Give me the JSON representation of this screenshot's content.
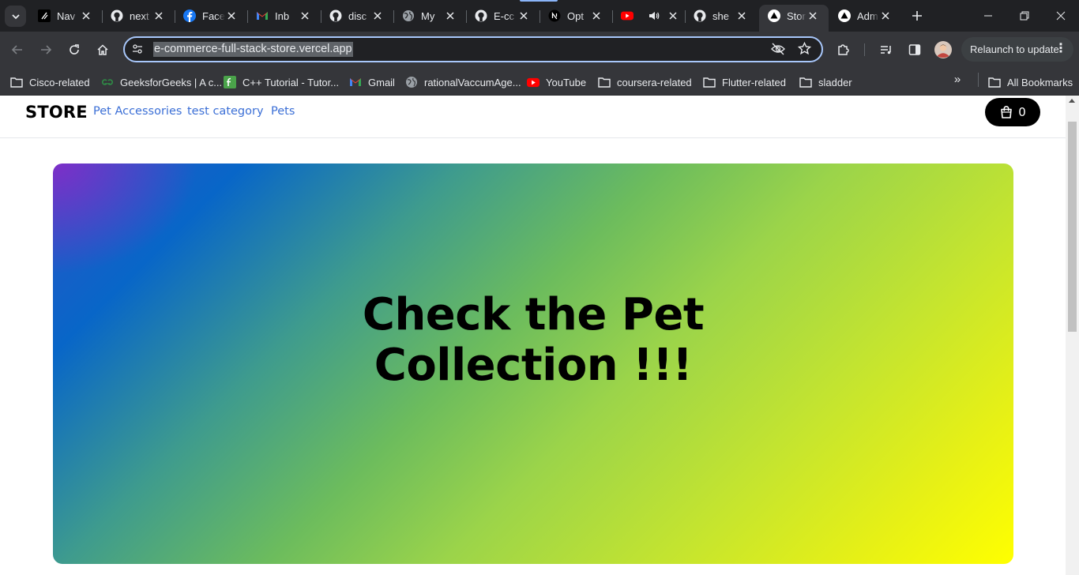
{
  "browser": {
    "tabs": [
      {
        "title": "Nav",
        "icon": "vercel-slash-icon"
      },
      {
        "title": "next",
        "icon": "github-icon"
      },
      {
        "title": "Face",
        "icon": "facebook-icon"
      },
      {
        "title": "Inb",
        "icon": "gmail-icon"
      },
      {
        "title": "disc",
        "icon": "github-icon"
      },
      {
        "title": "My",
        "icon": "globe-icon"
      },
      {
        "title": "E-cc",
        "icon": "github-icon"
      },
      {
        "title": "Opt",
        "icon": "nextjs-icon"
      },
      {
        "title": "",
        "icon": "youtube-icon"
      },
      {
        "title": "she",
        "icon": "github-icon"
      },
      {
        "title": "Stor",
        "icon": "vercel-triangle-icon",
        "active": true
      },
      {
        "title": "Adm",
        "icon": "vercel-triangle-icon"
      }
    ],
    "address": {
      "url": "e-commerce-full-stack-store.vercel.app"
    },
    "relaunch_label": "Relaunch to update",
    "bookmarks": [
      {
        "label": "Cisco-related",
        "icon": "folder-icon"
      },
      {
        "label": "GeeksforGeeks | A c...",
        "icon": "geeksforgeeks-icon"
      },
      {
        "label": "C++ Tutorial - Tutor...",
        "icon": "tutorial-icon"
      },
      {
        "label": "Gmail",
        "icon": "gmail-icon"
      },
      {
        "label": "rationalVaccumAge...",
        "icon": "globe-icon"
      },
      {
        "label": "YouTube",
        "icon": "youtube-icon"
      },
      {
        "label": "coursera-related",
        "icon": "folder-icon"
      },
      {
        "label": "Flutter-related",
        "icon": "folder-icon"
      },
      {
        "label": "sladder",
        "icon": "folder-icon"
      }
    ],
    "all_bookmarks_label": "All Bookmarks",
    "colors": {
      "chrome_dark": "#202124",
      "toolbar": "#35363a",
      "accent": "#8ab4f8"
    }
  },
  "site": {
    "logo": "STORE",
    "nav_links": [
      "Pet Accessories",
      "test category",
      "Pets"
    ],
    "cart_count": "0",
    "billboard": {
      "title_line1": "Check the Pet",
      "title_line2": "Collection !!!"
    },
    "colors": {
      "link": "#3b6fd6",
      "cart_bg": "#000000"
    }
  }
}
